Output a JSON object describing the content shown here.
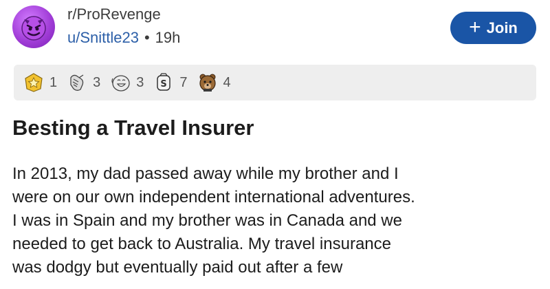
{
  "post": {
    "subreddit": "r/ProRevenge",
    "author": "u/Snittle23",
    "separator": "•",
    "time": "19h",
    "title": "Besting a Travel Insurer",
    "body_lines": [
      "In 2013, my dad passed away while my brother and I",
      "were on our own independent international adventures.",
      "I was in Spain and my brother was in Canada and we",
      "needed to get back to Australia. My travel insurance",
      "was dodgy but eventually paid out after a few"
    ]
  },
  "header": {
    "avatar_icon": "devil-face-icon",
    "join_icon": "plus-icon",
    "join_label": "Join",
    "join_color": "#1a55a6"
  },
  "awards": [
    {
      "icon": "gold-star-award-icon",
      "count": "1"
    },
    {
      "icon": "hand-fist-award-icon",
      "count": "3"
    },
    {
      "icon": "laughing-face-award-icon",
      "count": "3"
    },
    {
      "icon": "money-bag-award-icon",
      "count": "7"
    },
    {
      "icon": "bear-award-icon",
      "count": "4"
    }
  ]
}
